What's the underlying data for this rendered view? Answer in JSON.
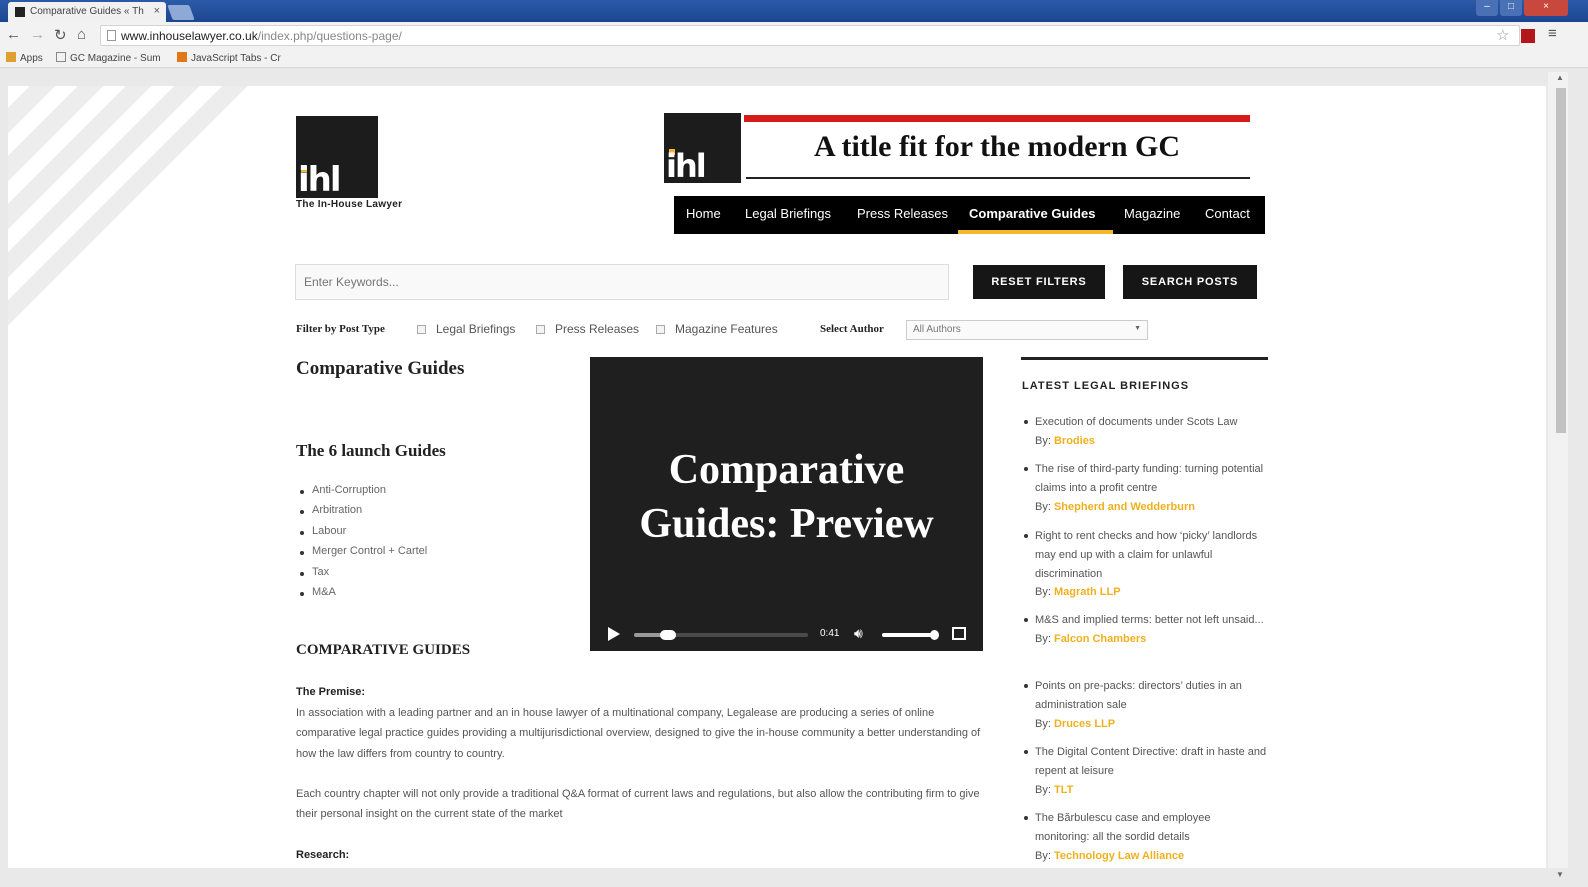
{
  "browser": {
    "tab_title": "Comparative Guides « Th",
    "tab_close": "×",
    "url_host": "www.inhouselawyer.co.uk",
    "url_path": "/index.php/questions-page/",
    "bookmarks": [
      "Apps",
      "GC Magazine - Sum",
      "JavaScript Tabs - Cr"
    ]
  },
  "site": {
    "logo_text": "ihl",
    "logo_caption": "The In-House Lawyer",
    "banner_title": "A title fit for the modern GC",
    "nav": [
      "Home",
      "Legal Briefings",
      "Press Releases",
      "Comparative Guides",
      "Magazine",
      "Contact"
    ],
    "nav_active": "Comparative Guides"
  },
  "search": {
    "placeholder": "Enter Keywords...",
    "reset_label": "RESET FILTERS",
    "search_label": "SEARCH POSTS"
  },
  "filters": {
    "post_type_label": "Filter by Post Type",
    "options": [
      "Legal Briefings",
      "Press Releases",
      "Magazine Features"
    ],
    "author_label": "Select Author",
    "author_value": "All Authors"
  },
  "content": {
    "heading": "Comparative Guides",
    "launch_heading": "The 6 launch Guides",
    "guides": [
      "Anti-Corruption",
      "Arbitration",
      "Labour",
      "Merger Control + Cartel",
      "Tax",
      "M&A"
    ],
    "section_heading": "COMPARATIVE GUIDES",
    "premise_label": "The Premise:",
    "premise_text": "In association with a leading partner and an in house lawyer of a multinational company, Legalease are producing a series of online comparative legal practice guides providing a multijurisdictional overview, designed to give the in-house community a better understanding of how the law differs from country to country.",
    "premise_text_2": "Each country chapter will not only provide a traditional Q&A format of current laws and regulations, but also allow the contributing firm to give their personal insight on the current state of the market",
    "research_label": "Research:"
  },
  "video": {
    "title_line1": "Comparative",
    "title_line2": "Guides: Preview",
    "time": "0:41",
    "progress": 0.24
  },
  "sidebar": {
    "title": "LATEST LEGAL BRIEFINGS",
    "by_label": "By:",
    "items": [
      {
        "title": "Execution of documents under Scots Law",
        "author": "Brodies"
      },
      {
        "title": "The rise of third-party funding: turning potential claims into a profit centre",
        "author": "Shepherd and Wedderburn"
      },
      {
        "title": "Right to rent checks and how ‘picky’ landlords may end up with a claim for unlawful discrimination",
        "author": "Magrath LLP"
      },
      {
        "title": "M&S and implied terms: better not left unsaid...",
        "author": "Falcon Chambers"
      },
      {
        "title": "Points on pre-packs: directors’ duties in an administration sale",
        "author": "Druces LLP"
      },
      {
        "title": "The Digital Content Directive: draft in haste and repent at leisure",
        "author": "TLT"
      },
      {
        "title": "The Bărbulescu case and employee monitoring: all the sordid details",
        "author": "Technology Law Alliance"
      }
    ]
  },
  "colors": {
    "accent": "#f3b72a",
    "banner_red": "#d71a1a",
    "nav_bg": "#000000"
  }
}
